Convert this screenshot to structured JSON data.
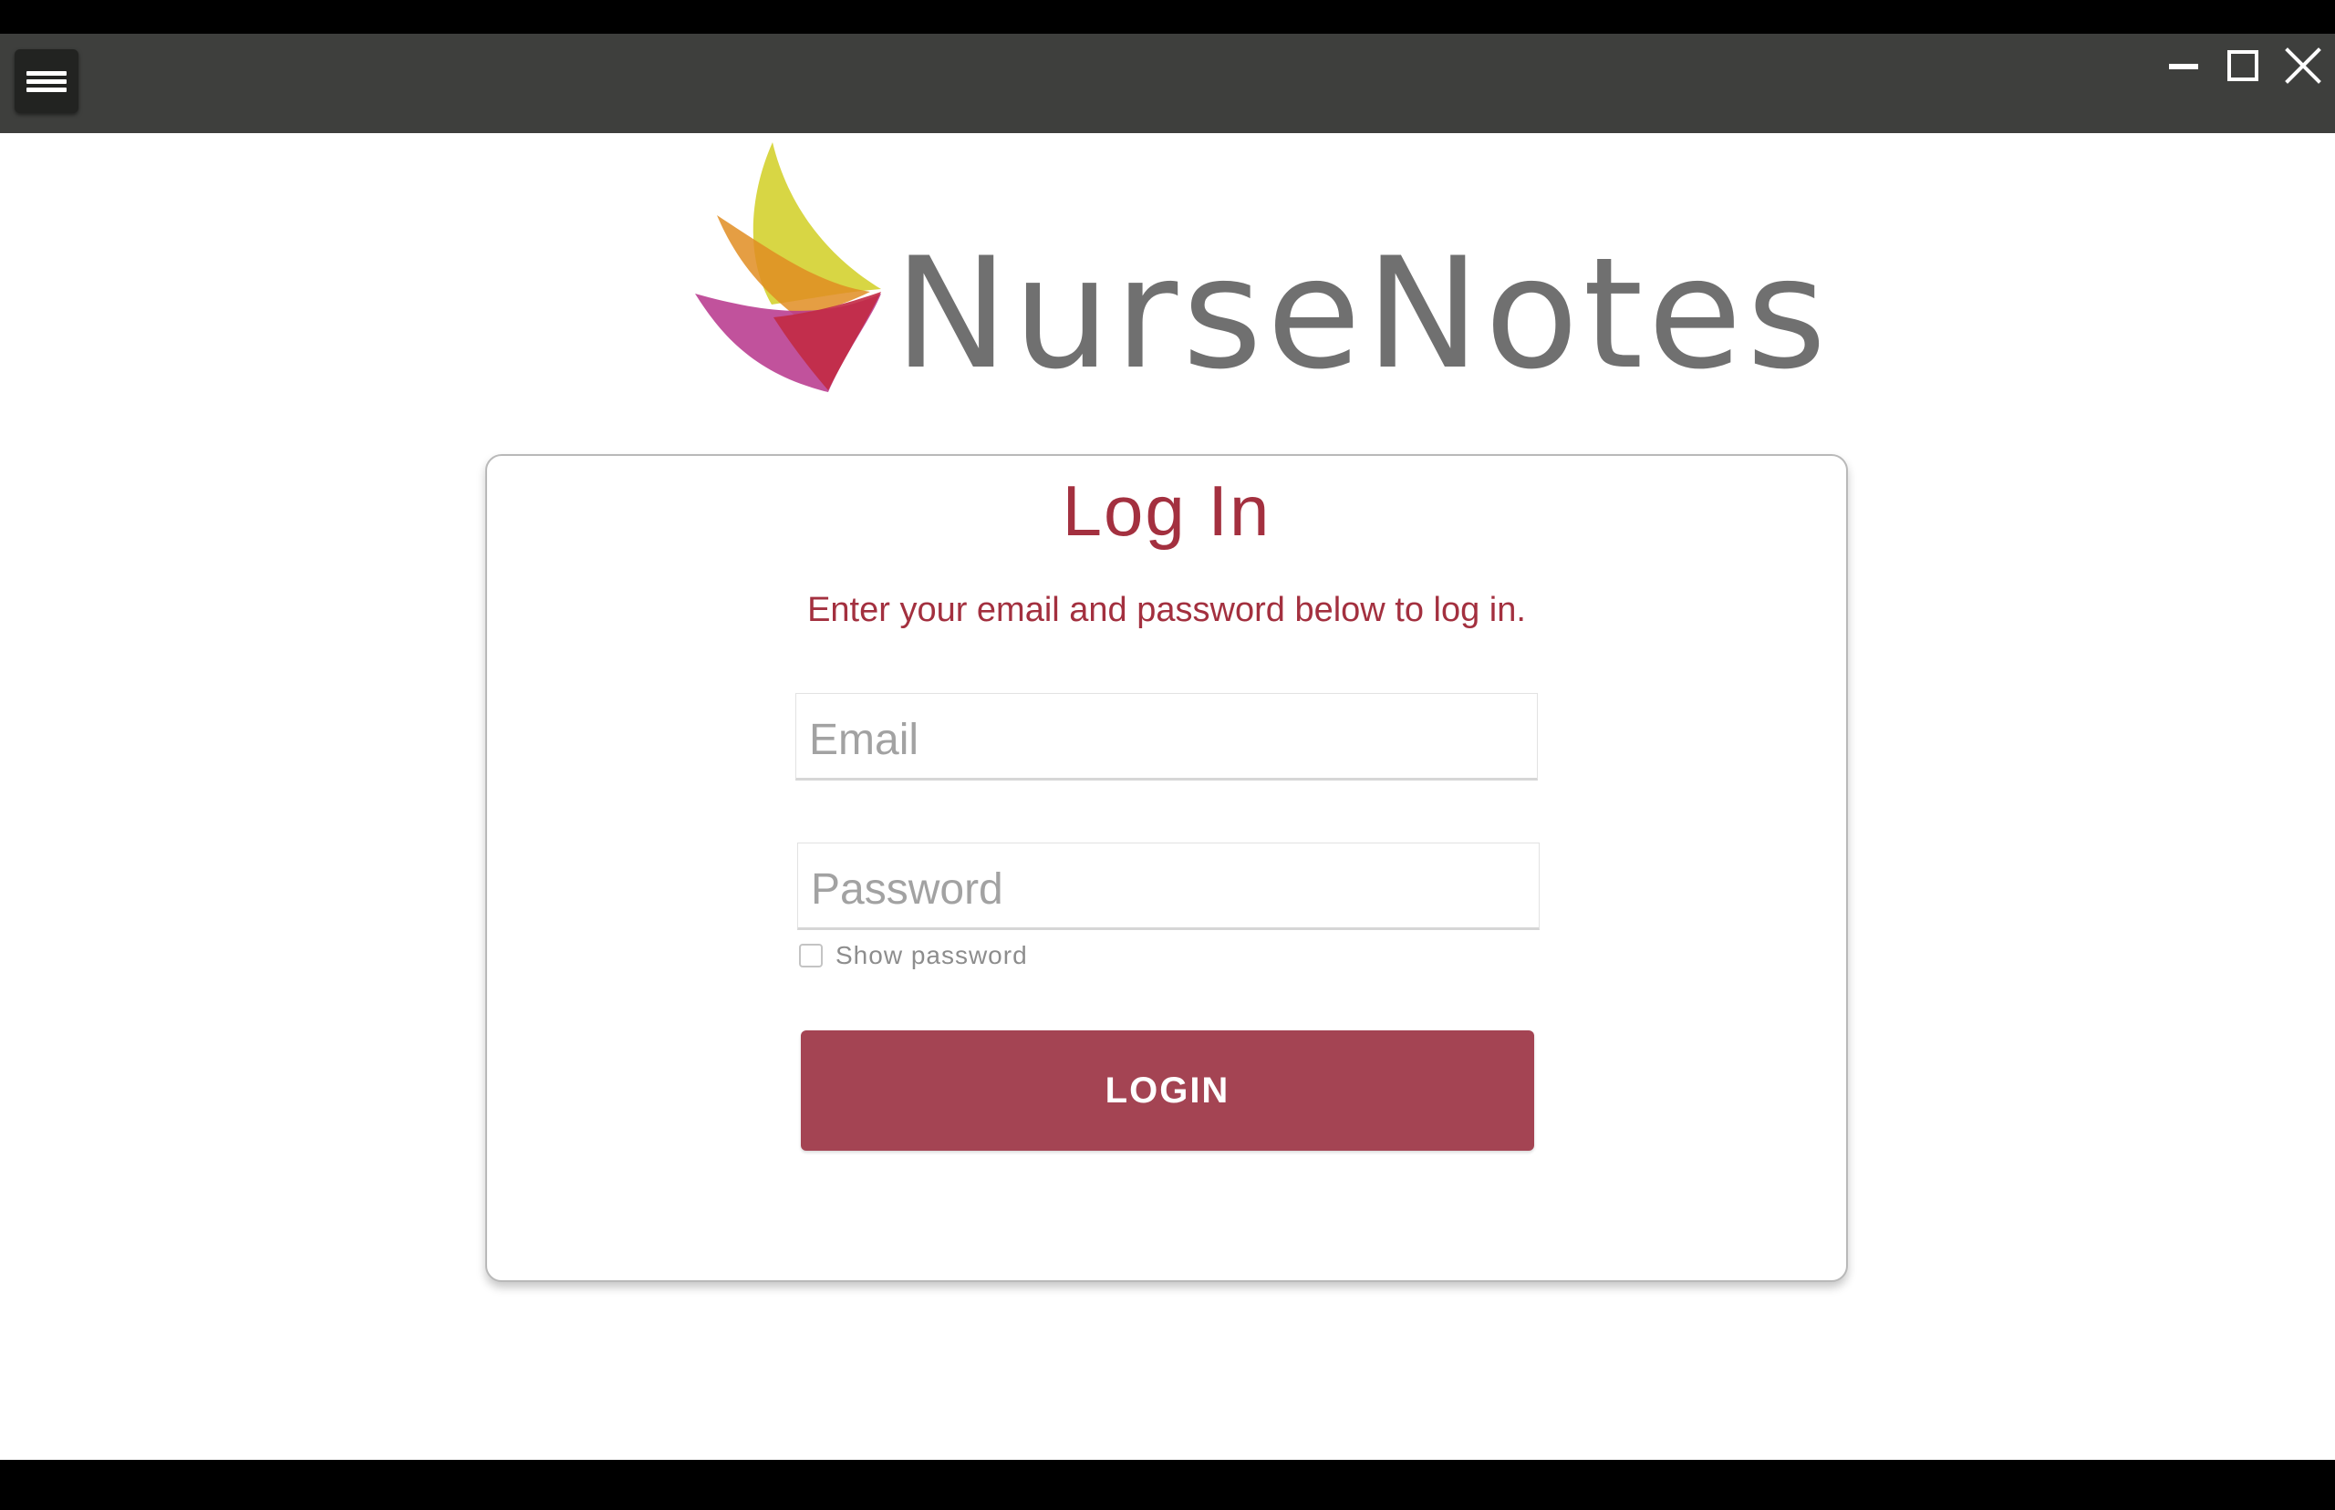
{
  "window": {
    "menu_icon": "hamburger-menu-icon",
    "controls": [
      "minimize-icon",
      "maximize-icon",
      "close-icon"
    ],
    "titlebar_color": "#3e3f3d"
  },
  "brand": {
    "name": "NurseNotes",
    "text_color": "#707070",
    "petal_colors": [
      "#d8d63c",
      "#e09b2a",
      "#b33a8a",
      "#c0304a"
    ]
  },
  "login": {
    "title": "Log In",
    "subtitle": "Enter your email and password below to log in.",
    "email_placeholder": "Email",
    "email_value": "",
    "password_placeholder": "Password",
    "password_value": "",
    "show_password_label": "Show password",
    "show_password_checked": false,
    "button_label": "LOGIN",
    "accent_color": "#a3303f",
    "button_color": "#a44453"
  }
}
